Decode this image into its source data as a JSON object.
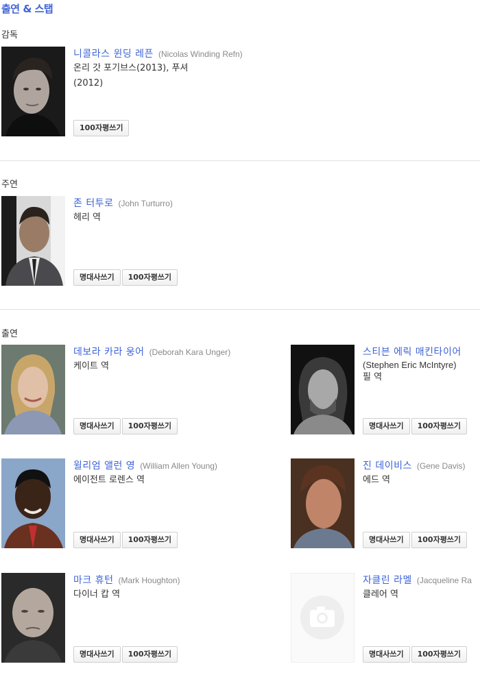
{
  "page": {
    "title": "출연 & 스탭"
  },
  "sections": {
    "director": "감독",
    "lead": "주연",
    "cast": "출연"
  },
  "buttons": {
    "quote": "명대사쓰기",
    "review": "100자평쓰기"
  },
  "director": {
    "name": "니콜라스 윈딩 레픈",
    "original": "(Nicolas Winding Refn)",
    "works_1": "온리 갓 포기브스(2013), 푸셔",
    "works_2": "(2012)"
  },
  "lead": {
    "name": "존 터투로",
    "original": "(John Turturro)",
    "role": "헤리 역"
  },
  "cast": [
    {
      "name": "데보라 카라 웅어",
      "original": "(Deborah Kara Unger)",
      "role": "케이트 역"
    },
    {
      "name": "스티븐 에릭 매킨타이어",
      "original": "(Stephen Eric McIntyre)",
      "role": "필 역"
    },
    {
      "name": "윌리엄 앨런 영",
      "original": "(William Allen Young)",
      "role": "에이전트 로렌스 역"
    },
    {
      "name": "진 데이비스",
      "original": "(Gene Davis)",
      "role": "에드 역"
    },
    {
      "name": "마크 휴턴",
      "original": "(Mark Houghton)",
      "role": "다이너 캅 역"
    },
    {
      "name": "자클린 라멜",
      "original": "(Jacqueline Ra",
      "role": "클레어 역"
    }
  ],
  "icons": {
    "placeholder_photo": "camera-icon"
  }
}
